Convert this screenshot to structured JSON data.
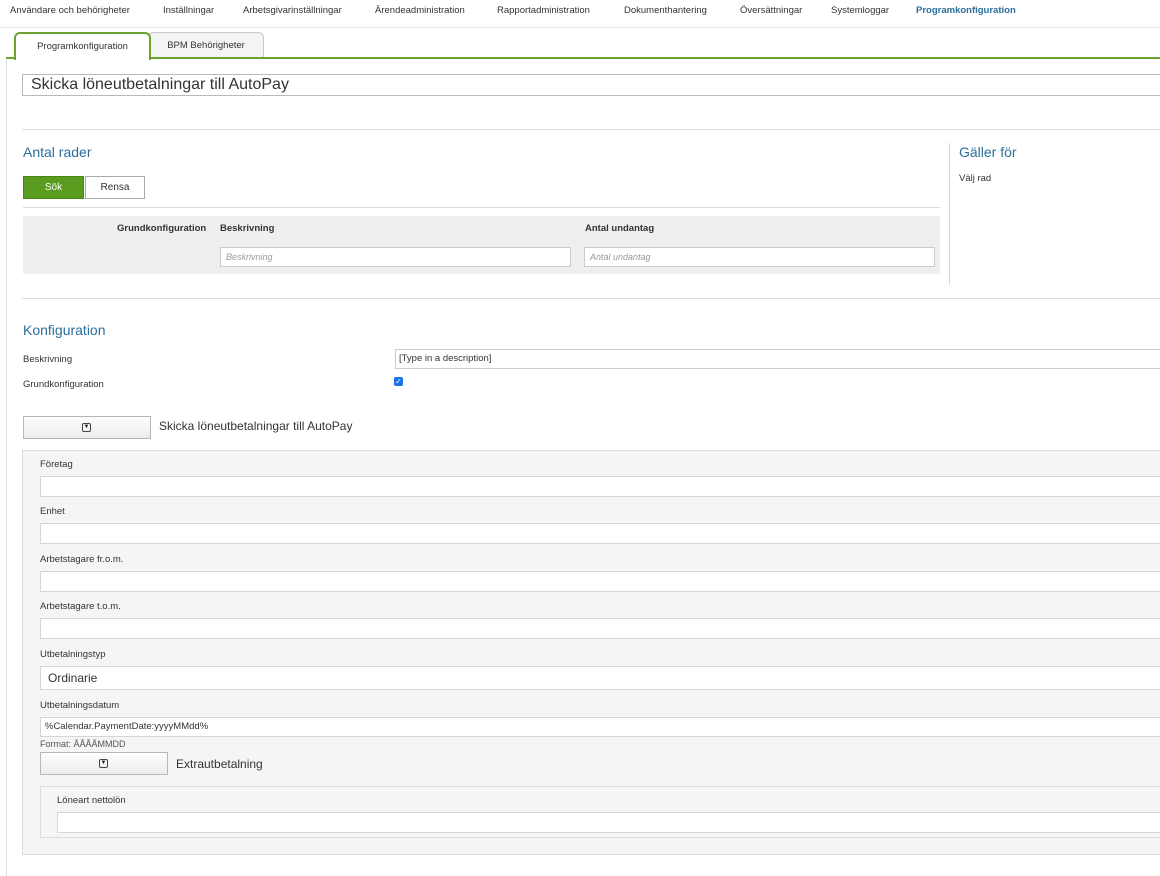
{
  "topnav": {
    "items": [
      "Användare och behörigheter",
      "Inställningar",
      "Arbetsgivarinställningar",
      "Ärendeadministration",
      "Rapportadministration",
      "Dokumenthantering",
      "Översättningar",
      "Systemloggar",
      "Programkonfiguration"
    ],
    "active": "Programkonfiguration"
  },
  "tabs": [
    "Programkonfiguration",
    "BPM Behörigheter"
  ],
  "config_title": "Skicka löneutbetalningar till AutoPay",
  "antal_rader": {
    "title": "Antal rader",
    "search_label": "Sök",
    "clear_label": "Rensa",
    "columns": [
      "Grundkonfiguration",
      "Beskrivning",
      "Antal undantag"
    ],
    "filter_placeholders": {
      "beskrivning": "Beskrivning",
      "antal_undantag": "Antal undantag"
    }
  },
  "galler_for": {
    "title": "Gäller för",
    "hint": "Välj rad"
  },
  "konfiguration": {
    "title": "Konfiguration",
    "beskrivning_label": "Beskrivning",
    "beskrivning_value": "[Type in a description]",
    "grundkonfiguration_label": "Grundkonfiguration",
    "grundkonfiguration_checked": true
  },
  "autopay": {
    "label": "Skicka löneutbetalningar till AutoPay",
    "fields": {
      "foretag": "Företag",
      "enhet": "Enhet",
      "arbetstagare_from": "Arbetstagare fr.o.m.",
      "arbetstagare_tom": "Arbetstagare t.o.m.",
      "utbetalningstyp": "Utbetalningstyp",
      "utbetalningstyp_value": "Ordinarie",
      "utbetalningsdatum": "Utbetalningsdatum",
      "utbetalningsdatum_value": "%Calendar.PaymentDate:yyyyMMdd%",
      "format_hint": "Format: ÅÅÅÅMMDD"
    },
    "extra": {
      "label": "Extrautbetalning",
      "loneart_nettolon": "Löneart nettolön"
    }
  }
}
